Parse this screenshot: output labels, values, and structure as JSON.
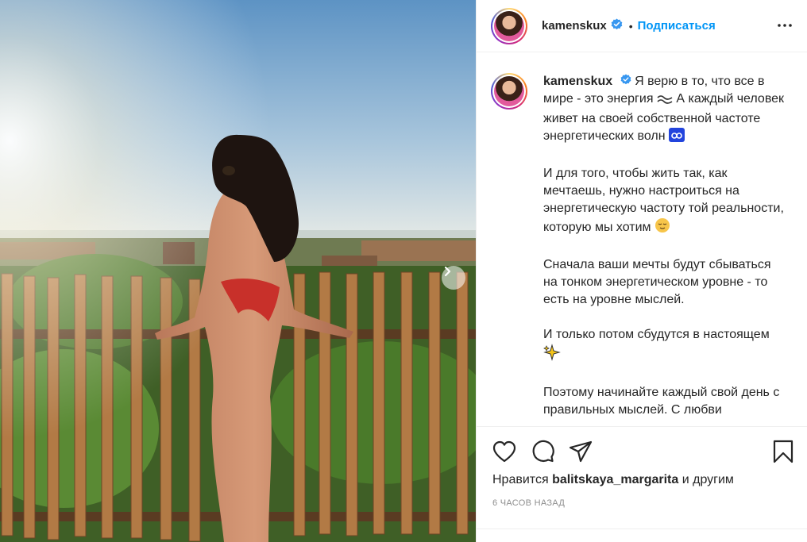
{
  "post": {
    "username": "kamenskux",
    "follow_label": "Подписаться",
    "separator": "•",
    "caption": {
      "username": "kamenskux",
      "p1_a": "Я верю в то, что все в мире - это энергия",
      "p1_b": "А каждый человек живет на своей собственной частоте энергетических волн",
      "p2": "И для того, чтобы жить так, как мечтаешь, нужно настроиться на энергетическую частоту той реальности, которую мы хотим",
      "p3": "Сначала ваши мечты будут сбываться на тонком энергетическом уровне - то есть на уровне мыслей.",
      "p4": "И только потом сбудутся в настоящем",
      "p5": "Поэтому начинайте каждый свой день с правильных мыслей. С любви"
    },
    "likes": {
      "prefix": "Нравится",
      "user": "balitskaya_margarita",
      "suffix": "и другим"
    },
    "time_ago": "6 часов назад"
  },
  "icons": {
    "like": "heart-icon",
    "comment": "comment-icon",
    "share": "paper-plane-icon",
    "save": "bookmark-icon",
    "more": "more-dots-icon",
    "next": "chevron-right-icon",
    "verified": "verified-badge-icon"
  },
  "colors": {
    "accent": "#0095f6",
    "text": "#262626",
    "muted": "#8e8e8e",
    "verified": "#3897f0"
  }
}
